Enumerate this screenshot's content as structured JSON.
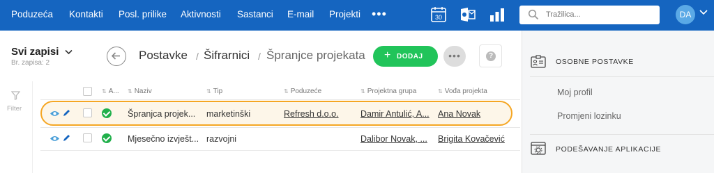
{
  "nav": {
    "items": [
      "Poduzeća",
      "Kontakti",
      "Posl. prilike",
      "Aktivnosti",
      "Sastanci",
      "E-mail",
      "Projekti"
    ],
    "more": "•••",
    "calendar_day": "30",
    "search_placeholder": "Tražilica...",
    "avatar_initials": "DA"
  },
  "records": {
    "title": "Svi zapisi",
    "count": "Br. zapisa: 2"
  },
  "breadcrumb": {
    "root": "Postavke",
    "level2": "Šifrarnici",
    "current": "Špranjce projekata",
    "sep": "/"
  },
  "actions": {
    "add_label": "DODAJ",
    "add_plus": "+",
    "more": "•••",
    "help": "?"
  },
  "filter": {
    "label": "Filter"
  },
  "table": {
    "columns": [
      "A...",
      "Naziv",
      "Tip",
      "Poduzeće",
      "Projektna grupa",
      "Vođa projekta"
    ],
    "rows": [
      {
        "naziv": "Špranjca projek...",
        "tip": "marketinški",
        "poduzece": "Refresh d.o.o.",
        "grupa": "Damir Antulić, A...",
        "voda": "Ana Novak",
        "selected": true
      },
      {
        "naziv": "Mjesečno izvješt...",
        "tip": "razvojni",
        "poduzece": "",
        "grupa": "Dalibor Novak, ...",
        "voda": "Brigita Kovačević",
        "selected": false
      }
    ]
  },
  "right_panel": {
    "section1": "OSOBNE POSTAVKE",
    "items": [
      "Moj profil",
      "Promjeni lozinku"
    ],
    "section2": "PODEŠAVANJE APLIKACIJE"
  },
  "colors": {
    "nav_bg": "#1565c0",
    "add_green": "#21c45a",
    "highlight": "#f5a623",
    "status": "#21b04b"
  }
}
